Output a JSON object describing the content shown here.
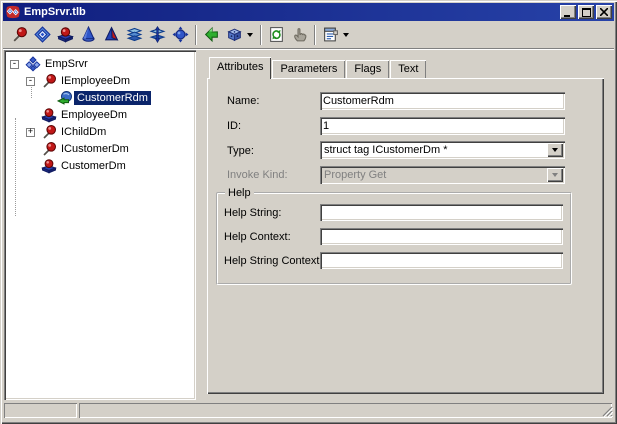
{
  "window": {
    "title": "EmpSrvr.tlb",
    "app_icon": "tlb-app-icon",
    "buttons": [
      "minimize",
      "maximize",
      "close"
    ]
  },
  "toolbar": {
    "buttons": [
      {
        "icon": "interface-pin-icon"
      },
      {
        "icon": "diamond-icon"
      },
      {
        "icon": "coclass-ball-icon"
      },
      {
        "icon": "enum-cone-icon"
      },
      {
        "icon": "record-pyramid-icon"
      },
      {
        "icon": "module-layers-icon"
      },
      {
        "icon": "union-layers-arrow-icon"
      },
      {
        "icon": "library-sphere-icon"
      },
      {
        "sep": true
      },
      {
        "icon": "go-arrow-icon"
      },
      {
        "icon": "cube-icon",
        "dropdown": true
      },
      {
        "sep": true
      },
      {
        "icon": "refresh-icon"
      },
      {
        "icon": "hand-icon",
        "disabled": true
      },
      {
        "sep": true
      },
      {
        "icon": "view-notes-icon",
        "dropdown": true
      }
    ]
  },
  "tree": {
    "items": [
      {
        "label": "EmpSrvr",
        "depth": 0,
        "expander": "-",
        "icon": "library-diamonds-icon",
        "selected": false
      },
      {
        "label": "IEmployeeDm",
        "depth": 1,
        "expander": "-",
        "icon": "interface-pin-icon",
        "selected": false
      },
      {
        "label": "CustomerRdm",
        "depth": 2,
        "expander": "",
        "icon": "property-get-icon",
        "selected": true
      },
      {
        "label": "EmployeeDm",
        "depth": 1,
        "expander": "",
        "icon": "coclass-ball-icon",
        "selected": false
      },
      {
        "label": "IChildDm",
        "depth": 1,
        "expander": "+",
        "icon": "interface-pin-icon",
        "selected": false
      },
      {
        "label": "ICustomerDm",
        "depth": 1,
        "expander": "",
        "icon": "interface-pin-icon",
        "selected": false
      },
      {
        "label": "CustomerDm",
        "depth": 1,
        "expander": "",
        "icon": "coclass-ball-icon",
        "selected": false
      }
    ]
  },
  "tabs": [
    {
      "label": "Attributes",
      "active": true
    },
    {
      "label": "Parameters",
      "active": false
    },
    {
      "label": "Flags",
      "active": false
    },
    {
      "label": "Text",
      "active": false
    }
  ],
  "form": {
    "name": {
      "label": "Name:",
      "value": "CustomerRdm"
    },
    "id": {
      "label": "ID:",
      "value": "1"
    },
    "type": {
      "label": "Type:",
      "value": "struct tag ICustomerDm *"
    },
    "invoke_kind": {
      "label": "Invoke Kind:",
      "value": "Property Get",
      "disabled": true
    },
    "help_group": {
      "title": "Help",
      "help_string": {
        "label": "Help String:",
        "value": ""
      },
      "help_context": {
        "label": "Help Context:",
        "value": ""
      },
      "help_string_context": {
        "label": "Help String Context:",
        "value": ""
      }
    }
  },
  "status": {
    "panel1": "",
    "panel2": ""
  },
  "colors": {
    "titlebar_left": "#101E7E",
    "titlebar_right": "#2742A8",
    "chrome": "#D4D0C8",
    "selection": "#0A246A",
    "disabled_text": "#808080"
  }
}
